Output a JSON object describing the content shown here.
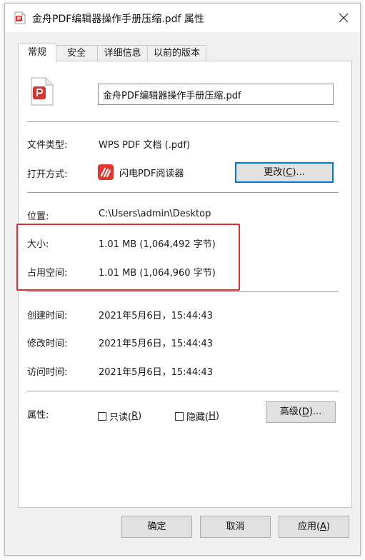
{
  "window": {
    "title": "金舟PDF编辑器操作手册压缩.pdf 属性",
    "close_icon": "close-icon"
  },
  "tabs": [
    {
      "label": "常规",
      "active": true
    },
    {
      "label": "安全",
      "active": false
    },
    {
      "label": "详细信息",
      "active": false
    },
    {
      "label": "以前的版本",
      "active": false
    }
  ],
  "general": {
    "filename": "金舟PDF编辑器操作手册压缩.pdf",
    "file_type_label": "文件类型:",
    "file_type_value": "WPS PDF 文档 (.pdf)",
    "open_with_label": "打开方式:",
    "open_with_value": "闪电PDF阅读器",
    "change_button": {
      "text": "更改(",
      "hotkey": "C",
      "suffix": ")..."
    },
    "location_label": "位置:",
    "location_value": "C:\\Users\\admin\\Desktop",
    "size_label": "大小:",
    "size_value": "1.01 MB (1,064,492 字节)",
    "size_on_disk_label": "占用空间:",
    "size_on_disk_value": "1.01 MB (1,064,960 字节)",
    "created_label": "创建时间:",
    "created_value": "2021年5月6日，15:44:43",
    "modified_label": "修改时间:",
    "modified_value": "2021年5月6日，15:44:43",
    "accessed_label": "访问时间:",
    "accessed_value": "2021年5月6日，15:44:43",
    "attributes_label": "属性:",
    "readonly": {
      "text": "只读(",
      "hotkey": "R",
      "suffix": ")",
      "checked": false
    },
    "hidden": {
      "text": "隐藏(",
      "hotkey": "H",
      "suffix": ")",
      "checked": false
    },
    "advanced_button": {
      "text": "高级(",
      "hotkey": "D",
      "suffix": ")..."
    }
  },
  "footer": {
    "ok": "确定",
    "cancel": "取消",
    "apply": {
      "text": "应用(",
      "hotkey": "A",
      "suffix": ")"
    }
  },
  "colors": {
    "highlight_box": "#e52e2e",
    "focus_border": "#0078d7",
    "pdf_icon_red": "#d9342b"
  },
  "icons": {
    "file": "pdf-file-icon",
    "app": "flash-pdf-reader-icon"
  }
}
